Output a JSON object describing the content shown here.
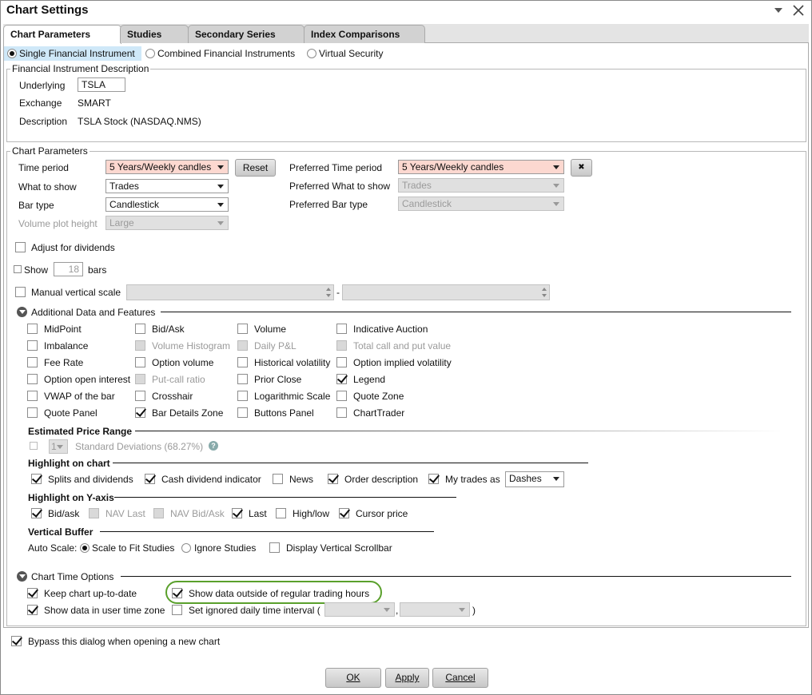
{
  "window": {
    "title": "Chart Settings"
  },
  "tabs": [
    "Chart Parameters",
    "Studies",
    "Secondary Series",
    "Index Comparisons"
  ],
  "instrument_type": {
    "options": [
      "Single Financial Instrument",
      "Combined Financial Instruments",
      "Virtual Security"
    ],
    "selected": "Single Financial Instrument"
  },
  "instrument": {
    "legend": "Financial Instrument Description",
    "underlying_label": "Underlying",
    "underlying_value": "TSLA",
    "exchange_label": "Exchange",
    "exchange_value": "SMART",
    "description_label": "Description",
    "description_value": "TSLA Stock (NASDAQ.NMS)"
  },
  "params": {
    "legend": "Chart Parameters",
    "time_period_label": "Time period",
    "time_period_value": "5 Years/Weekly candles",
    "reset_label": "Reset",
    "what_label": "What to show",
    "what_value": "Trades",
    "bar_type_label": "Bar type",
    "bar_type_value": "Candlestick",
    "volume_height_label": "Volume plot height",
    "volume_height_value": "Large",
    "pref_time_label": "Preferred Time period",
    "pref_time_value": "5 Years/Weekly candles",
    "clear_icon": "✖",
    "pref_what_label": "Preferred What to show",
    "pref_what_value": "Trades",
    "pref_bar_label": "Preferred Bar type",
    "pref_bar_value": "Candlestick",
    "adjust_dividends_label": "Adjust for dividends",
    "show_label": "Show",
    "show_bars_value": "18",
    "bars_label": "bars",
    "manual_scale_label": "Manual vertical scale",
    "scale_dash": "-"
  },
  "additional": {
    "title": "Additional Data and Features",
    "items": [
      {
        "label": "MidPoint",
        "checked": false,
        "disabled": false
      },
      {
        "label": "Bid/Ask",
        "checked": false,
        "disabled": false
      },
      {
        "label": "Volume",
        "checked": false,
        "disabled": false
      },
      {
        "label": "Indicative Auction",
        "checked": false,
        "disabled": false
      },
      {
        "label": "Imbalance",
        "checked": false,
        "disabled": false
      },
      {
        "label": "Volume Histogram",
        "checked": false,
        "disabled": true
      },
      {
        "label": "Daily P&L",
        "checked": false,
        "disabled": true
      },
      {
        "label": "Total call and put value",
        "checked": false,
        "disabled": true
      },
      {
        "label": "Fee Rate",
        "checked": false,
        "disabled": false
      },
      {
        "label": "Option volume",
        "checked": false,
        "disabled": false
      },
      {
        "label": "Historical volatility",
        "checked": false,
        "disabled": false
      },
      {
        "label": "Option implied volatility",
        "checked": false,
        "disabled": false
      },
      {
        "label": "Option open interest",
        "checked": false,
        "disabled": false
      },
      {
        "label": "Put-call ratio",
        "checked": false,
        "disabled": true
      },
      {
        "label": "Prior Close",
        "checked": false,
        "disabled": false
      },
      {
        "label": "Legend",
        "checked": true,
        "disabled": false
      },
      {
        "label": "VWAP of the bar",
        "checked": false,
        "disabled": false
      },
      {
        "label": "Crosshair",
        "checked": false,
        "disabled": false
      },
      {
        "label": "Logarithmic Scale",
        "checked": false,
        "disabled": false
      },
      {
        "label": "Quote Zone",
        "checked": false,
        "disabled": false
      },
      {
        "label": "Quote Panel",
        "checked": false,
        "disabled": false
      },
      {
        "label": "Bar Details Zone",
        "checked": true,
        "disabled": false
      },
      {
        "label": "Buttons Panel",
        "checked": false,
        "disabled": false
      },
      {
        "label": "ChartTrader",
        "checked": false,
        "disabled": false
      }
    ]
  },
  "estimated": {
    "title": "Estimated Price Range",
    "dev_value": "1",
    "dev_label": "Standard Deviations (68.27%)",
    "help_icon": "?"
  },
  "highlight_chart": {
    "title": "Highlight on chart",
    "items": [
      {
        "label": "Splits and dividends",
        "checked": true
      },
      {
        "label": "Cash dividend indicator",
        "checked": true
      },
      {
        "label": "News",
        "checked": false
      },
      {
        "label": "Order description",
        "checked": true
      },
      {
        "label": "My trades as",
        "checked": true
      }
    ],
    "trades_style": "Dashes"
  },
  "highlight_y": {
    "title": "Highlight on Y-axis",
    "items": [
      {
        "label": "Bid/ask",
        "checked": true,
        "disabled": false
      },
      {
        "label": "NAV Last",
        "checked": false,
        "disabled": true
      },
      {
        "label": "NAV Bid/Ask",
        "checked": false,
        "disabled": true
      },
      {
        "label": "Last",
        "checked": true,
        "disabled": false
      },
      {
        "label": "High/low",
        "checked": false,
        "disabled": false
      },
      {
        "label": "Cursor price",
        "checked": true,
        "disabled": false
      }
    ]
  },
  "vbuffer": {
    "title": "Vertical Buffer",
    "auto_scale_label": "Auto Scale:",
    "opt1": "Scale to Fit Studies",
    "opt2": "Ignore Studies",
    "scrollbar_label": "Display Vertical Scrollbar"
  },
  "time_options": {
    "title": "Chart Time Options",
    "keep_label": "Keep chart up-to-date",
    "outside_label": "Show data outside of regular trading hours",
    "user_tz_label": "Show data in user time zone",
    "ignored_label": "Set ignored daily time interval (",
    "comma": ",",
    "close_paren": ")"
  },
  "bypass_label": "Bypass this dialog when opening a new chart",
  "buttons": {
    "ok": "OK",
    "apply": "Apply",
    "cancel": "Cancel"
  },
  "colors": {
    "highlight_select": "#fcd8d0",
    "annotation_circle": "#5aa02c",
    "selected_radio_bg": "#cfe8f8"
  }
}
